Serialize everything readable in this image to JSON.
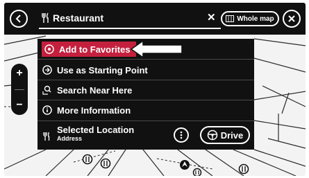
{
  "search": {
    "query": "Restaurant",
    "clear_label": "✕",
    "whole_map_label": "Whole map"
  },
  "zoom": {
    "in_label": "+",
    "out_label": "−"
  },
  "menu": {
    "items": [
      {
        "label": "Add to Favorites",
        "icon": "favorite-pin-icon"
      },
      {
        "label": "Use as Starting Point",
        "icon": "starting-point-icon"
      },
      {
        "label": "Search Near Here",
        "icon": "search-near-icon"
      },
      {
        "label": "More Information",
        "icon": "info-icon"
      }
    ],
    "selected": {
      "title": "Selected Location",
      "subtitle": "Address",
      "drive_label": "Drive"
    }
  },
  "colors": {
    "accent": "#c4203e",
    "bar": "#111111",
    "map_bg": "#f3f3f3"
  }
}
